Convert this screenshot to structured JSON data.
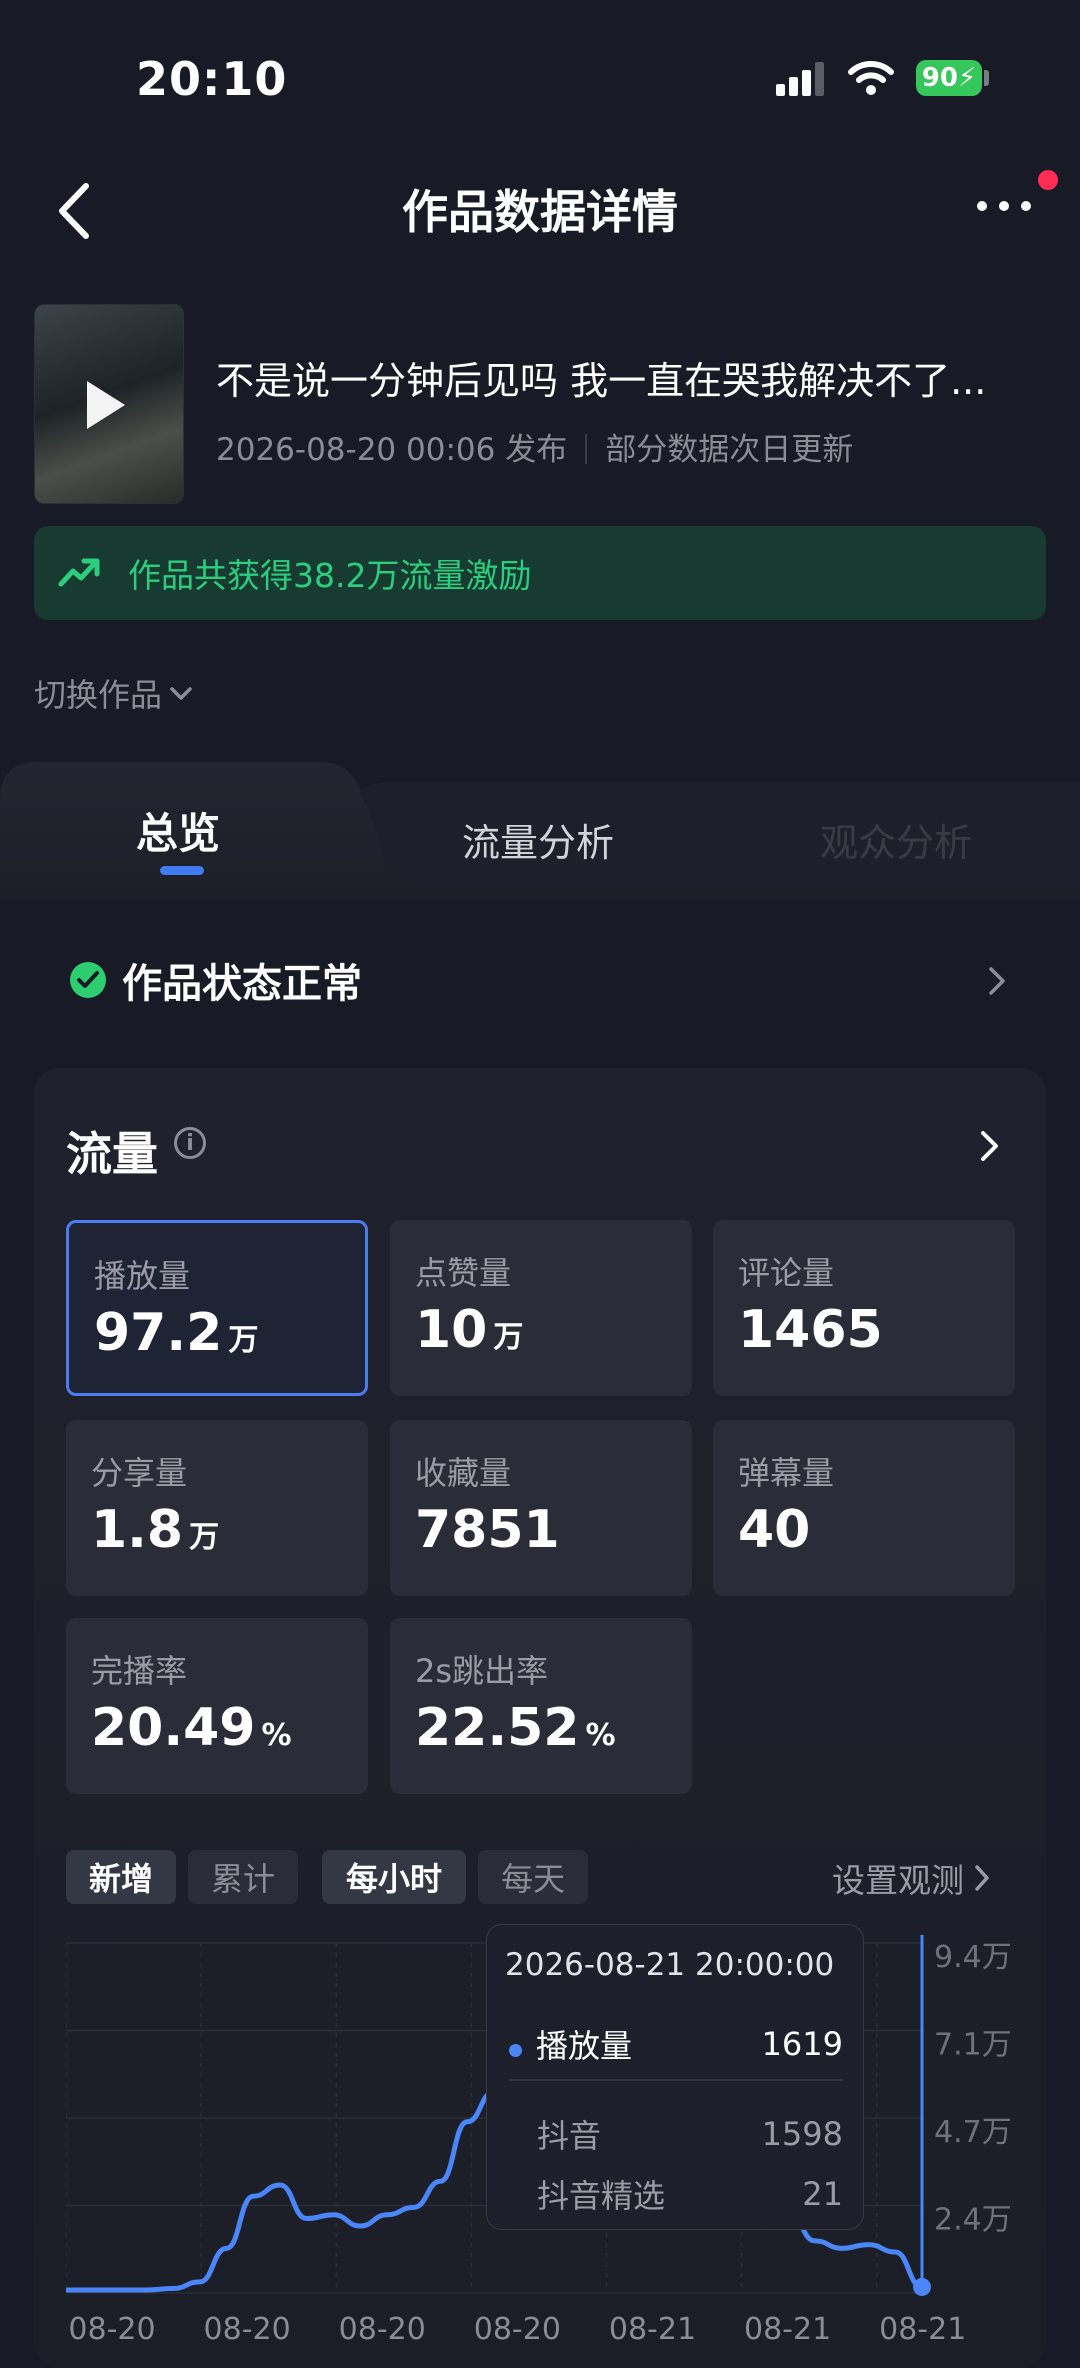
{
  "status_bar": {
    "time": "20:10",
    "battery": "90"
  },
  "nav": {
    "title": "作品数据详情"
  },
  "video": {
    "title": "不是说一分钟后见吗 我一直在哭我解决不了...",
    "publish_time": "2026-08-20 00:06 发布",
    "update_note": "部分数据次日更新"
  },
  "banner": {
    "text": "作品共获得38.2万流量激励"
  },
  "switch_label": "切换作品",
  "tabs": {
    "active": "总览",
    "second": "流量分析",
    "third": "观众分析"
  },
  "status": {
    "text": "作品状态正常"
  },
  "flow": {
    "title": "流量",
    "cards": [
      {
        "label": "播放量",
        "value": "97.2",
        "unit": "万",
        "selected": true
      },
      {
        "label": "点赞量",
        "value": "10",
        "unit": "万"
      },
      {
        "label": "评论量",
        "value": "1465",
        "unit": ""
      },
      {
        "label": "分享量",
        "value": "1.8",
        "unit": "万"
      },
      {
        "label": "收藏量",
        "value": "7851",
        "unit": ""
      },
      {
        "label": "弹幕量",
        "value": "40",
        "unit": ""
      },
      {
        "label": "完播率",
        "value": "20.49",
        "unit": "%"
      },
      {
        "label": "2s跳出率",
        "value": "22.52",
        "unit": "%"
      }
    ]
  },
  "chart_controls": {
    "new": "新增",
    "cumulative": "累计",
    "hourly": "每小时",
    "daily": "每天",
    "observe": "设置观测"
  },
  "tooltip": {
    "time": "2026-08-21 20:00:00",
    "metric": "播放量",
    "metric_value": "1619",
    "sources": [
      {
        "name": "抖音",
        "value": "1598"
      },
      {
        "name": "抖音精选",
        "value": "21"
      }
    ]
  },
  "colors": {
    "accent": "#3f7cf4",
    "line": "#4a86f7",
    "green": "#2ccd7e",
    "banner_bg": "#173b30"
  },
  "chart_data": {
    "type": "line",
    "title": "",
    "xlabel": "",
    "ylabel": "",
    "x": [
      0,
      1,
      2,
      3,
      4,
      5,
      6,
      7,
      8,
      9,
      10,
      11,
      12,
      13,
      14,
      15,
      16,
      17,
      18,
      19,
      20,
      21,
      22,
      23,
      24,
      25,
      26,
      27,
      28,
      29,
      30,
      31,
      32,
      33,
      34,
      35,
      36,
      37,
      38,
      39,
      40,
      41,
      42,
      43,
      44,
      45,
      46,
      47,
      48,
      49,
      50,
      51,
      52,
      53,
      54,
      55,
      56,
      57,
      58,
      59,
      60,
      61,
      62,
      63,
      64,
      65,
      66,
      67,
      68,
      69,
      70,
      71,
      72,
      73,
      74,
      75,
      76,
      77,
      78,
      79,
      80,
      81,
      82,
      83,
      84,
      85,
      86,
      87,
      88,
      89,
      90,
      91,
      92,
      93,
      94,
      95,
      96,
      97,
      98,
      99,
      100,
      101,
      102,
      103,
      104,
      105,
      106,
      107,
      108,
      109,
      110,
      111,
      112,
      113,
      114,
      115,
      116,
      117,
      118,
      119,
      120,
      121,
      122,
      123,
      124,
      125,
      126,
      127,
      128,
      129,
      130,
      131,
      132,
      133,
      134,
      135,
      136,
      137,
      138,
      139,
      140,
      141,
      142,
      143,
      144,
      145,
      146,
      147,
      148,
      149,
      150,
      151,
      152,
      153,
      154,
      155,
      156,
      157,
      158,
      159,
      160,
      161,
      162,
      163,
      164,
      165,
      166,
      167,
      168,
      169,
      170,
      171,
      172,
      173,
      174,
      175,
      176,
      177,
      178,
      179,
      180,
      181,
      182,
      183,
      184,
      185,
      186,
      187,
      188,
      189,
      190,
      191,
      192,
      193,
      194,
      195,
      196,
      197,
      198,
      199,
      200,
      201,
      202,
      203,
      204,
      205,
      206,
      207,
      208,
      209,
      210,
      211,
      212,
      213,
      214,
      215,
      216,
      217,
      218,
      219,
      220,
      221,
      222,
      223,
      224,
      225,
      226,
      227,
      228,
      229,
      230,
      231,
      232,
      233,
      234,
      235,
      236,
      237,
      238,
      239,
      240,
      241,
      242,
      243,
      244,
      245,
      246,
      247,
      248,
      249,
      250,
      251,
      252,
      253,
      254,
      255,
      256,
      257,
      258,
      259,
      260,
      261,
      262,
      263,
      264,
      265,
      266,
      267,
      268,
      269,
      270,
      271,
      272,
      273,
      274,
      275,
      276,
      277,
      278,
      279,
      280,
      281,
      282,
      283,
      284,
      285,
      286,
      287,
      288,
      289,
      290,
      291,
      292,
      293,
      294,
      295,
      296,
      297,
      298,
      299,
      300,
      301,
      302,
      303,
      304,
      305,
      306,
      307,
      308,
      309,
      310,
      311,
      312,
      313,
      314,
      315,
      316,
      317,
      318,
      319,
      320,
      321,
      322,
      323,
      324,
      325,
      326,
      327,
      328,
      329,
      330,
      331,
      332,
      333,
      334,
      335,
      336,
      337,
      338,
      339,
      340,
      341,
      342,
      343,
      344,
      345,
      346,
      347,
      348,
      349,
      350,
      351,
      352,
      353,
      354,
      355,
      356,
      357,
      358,
      359,
      360,
      361,
      362,
      363,
      364,
      365,
      366,
      367,
      368,
      369,
      370,
      371,
      372,
      373,
      374,
      375,
      376,
      377,
      378,
      379,
      380,
      381,
      382,
      383,
      384,
      385,
      386,
      387,
      388,
      389,
      390,
      391,
      392,
      393,
      394,
      395,
      396,
      397,
      398,
      399,
      400,
      401,
      402,
      403,
      404,
      405,
      406,
      407,
      408,
      409,
      410,
      411,
      412,
      413,
      414,
      415,
      416,
      417,
      418,
      419,
      420,
      421,
      422,
      423,
      424,
      425,
      426,
      427,
      428,
      429,
      430,
      431,
      432,
      433,
      434,
      435,
      436,
      437,
      438,
      439,
      440,
      441,
      442,
      443,
      444,
      445,
      446,
      447,
      448,
      449,
      450,
      451,
      452,
      453,
      454,
      455,
      456,
      457,
      458,
      459,
      460,
      461,
      462,
      463,
      464,
      465,
      466,
      467,
      468,
      469,
      470,
      471,
      472,
      473,
      474,
      475,
      476,
      477,
      478,
      479,
      480,
      481,
      482,
      483,
      484,
      485,
      486,
      487,
      488,
      489,
      490,
      491,
      492,
      493,
      494,
      495,
      496,
      497,
      498,
      499,
      500,
      501,
      502,
      503,
      504,
      505,
      506,
      507,
      508,
      509,
      510,
      511,
      512,
      513,
      514,
      515,
      516,
      517,
      518,
      519,
      520,
      521,
      522,
      523,
      524,
      525,
      526,
      527,
      528,
      529,
      530,
      531,
      532,
      533,
      534,
      535,
      536,
      537,
      538,
      539,
      540,
      541,
      542,
      543,
      544,
      545,
      546,
      547,
      548,
      549,
      550,
      551,
      552,
      553,
      554,
      555,
      556,
      557,
      558,
      559,
      560,
      561,
      562,
      563,
      564,
      565,
      566,
      567,
      568,
      569,
      570,
      571,
      572,
      573,
      574,
      575,
      576,
      577,
      578,
      579,
      580,
      581,
      582,
      583,
      584,
      585,
      586,
      587,
      588,
      589,
      590,
      591,
      592,
      593,
      594,
      595,
      596,
      597,
      598,
      599,
      600,
      601,
      602,
      603,
      604,
      605,
      606,
      607,
      608,
      609,
      610,
      611,
      612,
      613,
      614,
      615,
      616,
      617,
      618,
      619,
      620,
      621,
      622,
      623,
      624,
      625,
      626,
      627,
      628,
      629,
      630,
      631,
      632,
      633,
      634,
      635,
      636,
      637,
      638,
      639,
      640,
      641,
      642,
      643,
      644,
      645,
      646,
      647,
      648,
      649,
      650,
      651,
      652,
      653,
      654,
      655,
      656,
      657,
      658,
      659,
      660,
      661,
      662,
      663,
      664,
      665,
      666,
      667,
      668,
      669,
      670,
      671,
      672,
      673,
      674,
      675,
      676,
      677,
      678,
      679,
      680,
      681,
      682,
      683,
      684,
      685,
      686,
      687,
      688,
      689,
      690,
      691,
      692,
      693,
      694,
      695,
      696,
      697,
      698,
      699,
      700,
      701,
      702,
      703,
      704,
      705,
      706,
      707,
      708,
      709,
      710,
      711,
      712,
      713,
      714,
      715,
      716,
      717,
      718,
      719,
      720,
      721,
      722,
      723,
      724,
      725,
      726,
      727,
      728,
      729,
      730,
      731,
      732,
      733,
      734,
      735,
      736,
      737,
      738,
      739,
      740,
      741,
      742,
      743,
      744,
      745,
      746,
      747,
      748,
      749,
      750,
      751,
      752,
      753,
      754,
      755,
      756,
      757,
      758,
      759,
      760,
      761,
      762,
      763,
      764,
      765,
      766,
      767,
      768,
      769,
      770,
      771,
      772,
      773,
      774,
      775,
      776,
      777,
      778,
      779,
      780,
      781,
      782,
      783,
      784,
      785,
      786,
      787,
      788,
      789,
      790,
      791,
      792,
      793,
      794,
      795,
      796,
      797,
      798,
      799,
      800,
      801,
      802,
      803,
      804,
      805,
      806,
      807,
      808,
      809,
      810,
      811,
      812,
      813,
      814,
      815,
      816,
      817,
      818,
      819,
      820,
      821,
      822,
      823,
      824,
      825,
      826,
      827,
      828,
      829,
      830,
      831,
      832,
      833,
      834,
      835,
      836,
      837,
      838,
      839,
      840,
      841,
      842,
      843,
      844,
      845,
      846,
      847,
      848,
      849,
      850,
      851,
      852,
      853,
      854,
      855,
      856,
      857,
      858,
      859,
      860,
      861,
      862,
      863,
      864,
      865,
      866,
      867,
      868,
      869,
      870,
      871,
      872,
      873,
      874,
      875,
      876,
      877,
      878,
      879,
      880,
      881,
      882,
      883,
      884,
      885,
      886,
      887,
      888,
      889,
      890,
      891,
      892,
      893,
      894,
      895,
      896,
      897,
      898,
      899,
      900,
      901,
      902,
      903,
      904,
      905,
      906,
      907,
      908,
      909,
      910,
      911,
      912,
      913,
      914,
      915,
      916,
      917,
      918,
      919,
      920,
      921,
      922,
      923,
      924,
      925,
      926,
      927,
      928,
      929,
      930,
      931,
      932,
      933,
      934,
      935,
      936,
      937,
      938,
      939,
      940,
      941,
      942,
      943,
      944,
      945,
      946,
      947,
      948,
      949,
      950,
      951,
      952,
      953,
      954,
      955,
      956,
      957,
      958,
      959,
      960,
      961,
      962,
      963,
      964,
      965,
      966,
      967,
      968,
      969,
      970,
      971,
      972,
      973,
      974,
      975,
      976,
      977,
      978,
      979,
      980,
      981,
      982,
      983,
      984,
      985,
      986,
      987,
      988,
      989,
      990,
      991,
      992,
      993,
      994,
      995,
      996,
      997,
      998,
      999
    ],
    "xtick_labels": [
      "08-20",
      "08-20",
      "08-20",
      "08-20",
      "08-21",
      "08-21",
      "08-21"
    ],
    "ytick_labels": [
      "2.4万",
      "4.7万",
      "7.1万",
      "9.4万"
    ],
    "ylim": [
      0,
      94000
    ],
    "series": [
      {
        "values_sample": [
          800,
          800,
          800,
          800,
          1200,
          3000,
          12000,
          26000,
          29000,
          20000,
          21000,
          18000,
          21000,
          23000,
          30000,
          46000,
          54000,
          60000,
          50000,
          42000,
          30000,
          22000,
          18000,
          22000,
          38000,
          42000,
          30000,
          22000,
          14000,
          12000,
          13000,
          11000,
          1619
        ]
      }
    ]
  }
}
